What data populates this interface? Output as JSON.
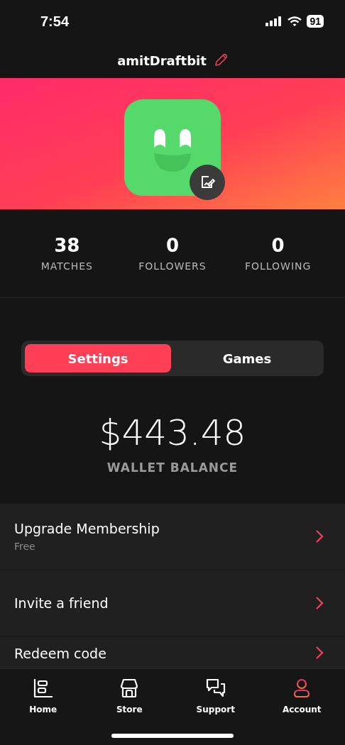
{
  "status_bar": {
    "time": "7:54",
    "battery": "91"
  },
  "header": {
    "username": "amitDraftbit"
  },
  "stats": [
    {
      "value": "38",
      "label": "MATCHES"
    },
    {
      "value": "0",
      "label": "FOLLOWERS"
    },
    {
      "value": "0",
      "label": "FOLLOWING"
    }
  ],
  "segments": [
    {
      "label": "Settings",
      "selected": true
    },
    {
      "label": "Games",
      "selected": false
    }
  ],
  "wallet": {
    "amount": "$443.48",
    "label": "WALLET BALANCE"
  },
  "menu": [
    {
      "title": "Upgrade Membership",
      "subtitle": "Free"
    },
    {
      "title": "Invite a friend"
    },
    {
      "title": "Redeem code"
    }
  ],
  "tab_bar": [
    {
      "label": "Home",
      "selected": false
    },
    {
      "label": "Store",
      "selected": false
    },
    {
      "label": "Support",
      "selected": false
    },
    {
      "label": "Account",
      "selected": true
    }
  ]
}
